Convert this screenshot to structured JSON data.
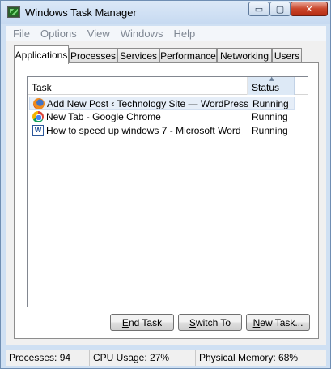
{
  "window": {
    "title": "Windows Task Manager",
    "icon": "task-manager-icon",
    "controls": {
      "minimize": "▭",
      "maximize": "▢",
      "close": "✕"
    }
  },
  "menu": [
    "File",
    "Options",
    "View",
    "Windows",
    "Help"
  ],
  "tabs": [
    "Applications",
    "Processes",
    "Services",
    "Performance",
    "Networking",
    "Users"
  ],
  "active_tab": "Applications",
  "list": {
    "columns": {
      "task": "Task",
      "status": "Status"
    },
    "sort_indicator": "▲",
    "rows": [
      {
        "icon": "firefox-icon",
        "task": "Add New Post ‹ Technology Site — WordPress - ...",
        "status": "Running",
        "selected": true
      },
      {
        "icon": "chrome-icon",
        "task": "New Tab - Google Chrome",
        "status": "Running",
        "selected": false
      },
      {
        "icon": "word-document-icon",
        "icon_glyph": "W",
        "task": "How to speed up windows 7 - Microsoft Word",
        "status": "Running",
        "selected": false
      }
    ]
  },
  "buttons": {
    "end_task": "End Task",
    "switch_to": "Switch To",
    "new_task": "New Task..."
  },
  "statusbar": {
    "processes": "Processes: 94",
    "cpu": "CPU Usage: 27%",
    "memory": "Physical Memory: 68%"
  }
}
